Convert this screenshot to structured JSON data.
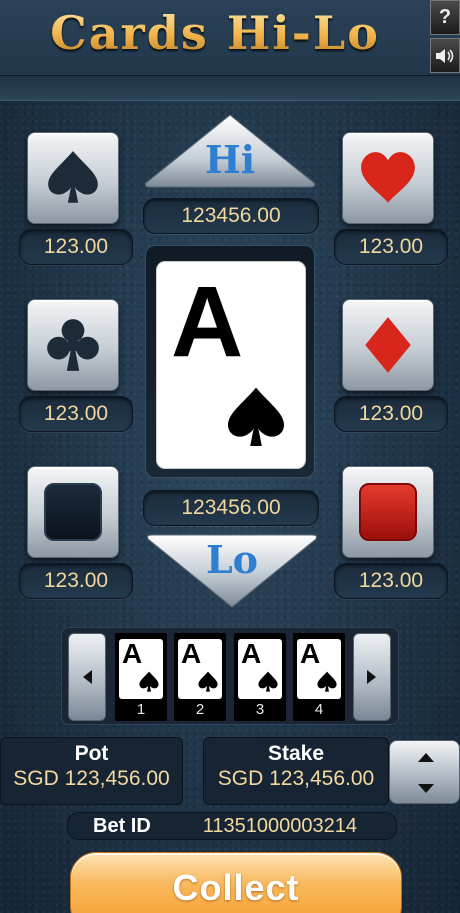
{
  "header": {
    "title": "Cards Hi-Lo",
    "help_label": "?",
    "sound_icon": "speaker-icon"
  },
  "hi": {
    "label": "Hi",
    "payout": "123456.00"
  },
  "lo": {
    "label": "Lo",
    "payout": "123456.00"
  },
  "suit_bets": {
    "spade": "123.00",
    "heart": "123.00",
    "club": "123.00",
    "diamond": "123.00",
    "black": "123.00",
    "red": "123.00"
  },
  "current_card": {
    "rank": "A",
    "suit": "spade"
  },
  "history": [
    {
      "rank": "A",
      "suit": "spade",
      "index": "1"
    },
    {
      "rank": "A",
      "suit": "spade",
      "index": "2"
    },
    {
      "rank": "A",
      "suit": "spade",
      "index": "3"
    },
    {
      "rank": "A",
      "suit": "spade",
      "index": "4"
    }
  ],
  "pot": {
    "label": "Pot",
    "value": "SGD 123,456.00"
  },
  "stake": {
    "label": "Stake",
    "value": "SGD 123,456.00"
  },
  "bet": {
    "label": "Bet ID",
    "value": "11351000003214"
  },
  "collect_label": "Collect",
  "colors": {
    "accent_gold": "#f1c060",
    "hi_lo_blue": "#2f7fd1",
    "red_suit": "#d9261c",
    "collect_orange": "#f59c2a"
  }
}
